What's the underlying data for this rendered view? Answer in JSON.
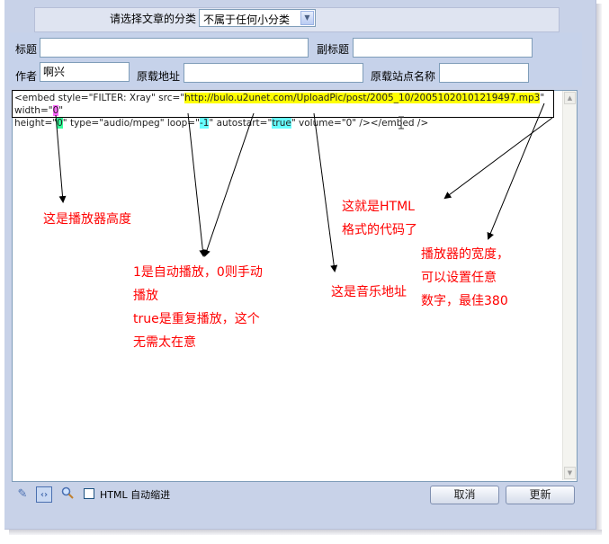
{
  "category": {
    "label": "请选择文章的分类",
    "selected": "不属于任何小分类"
  },
  "fields": {
    "title_label": "标题",
    "title_value": "",
    "subtitle_label": "副标题",
    "subtitle_value": "",
    "author_label": "作者",
    "author_value": "啊兴",
    "source_url_label": "原载地址",
    "source_url_value": "",
    "source_site_label": "原载站点名称",
    "source_site_value": ""
  },
  "code": {
    "part1": "<embed style=\"FILTER: Xray\" src=\"",
    "src": "http://bulo.u2unet.com/UploadPic/post/2005_10/20051020101219497.mp3",
    "part2": "\" width=\"",
    "width": "0",
    "part3": "\"",
    "part4": "height=\"",
    "height": "0",
    "part5": "\" type=\"audio/mpeg\" loop=\"",
    "loop": "-1",
    "part6": "\" autostart=\"",
    "autostart": "true",
    "part7": "\" volume=\"0\" /></embed />"
  },
  "annotations": {
    "height_note": "这是播放器高度",
    "autoplay_line1": "1是自动播放，0则手动",
    "autoplay_line2": "播放",
    "autoplay_line3": "true是重复播放，这个",
    "autoplay_line4": "无需太在意",
    "music_note": "这是音乐地址",
    "html_line1": "这就是HTML",
    "html_line2": "格式的代码了",
    "width_line1": "播放器的宽度，",
    "width_line2": "可以设置任意",
    "width_line3": "数字，最佳380"
  },
  "toolbar": {
    "auto_indent_label": "HTML 自动缩进",
    "cancel_label": "取消",
    "update_label": "更新"
  },
  "colors": {
    "annotation": "#ff0000",
    "highlight_src": "#ffff00",
    "highlight_height": "#33ff99",
    "highlight_autostart": "#66ffff",
    "highlight_width": "#ff66ff"
  }
}
